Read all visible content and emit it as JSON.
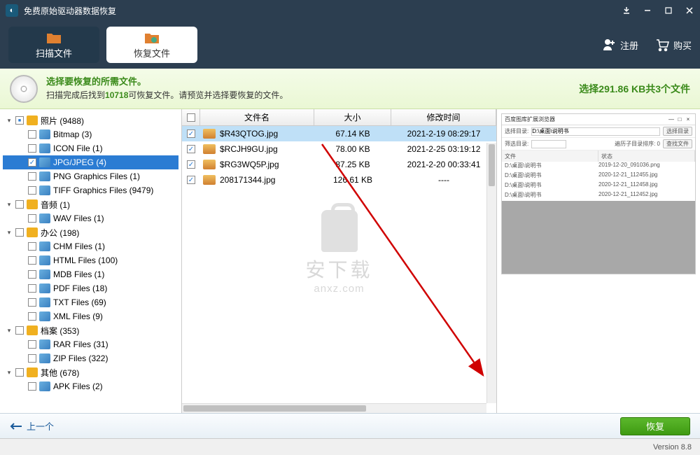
{
  "titlebar": {
    "title": "免费原始驱动器数据恢复"
  },
  "header": {
    "tab_scan": "扫描文件",
    "tab_recover": "恢复文件",
    "register": "注册",
    "buy": "购买"
  },
  "infobar": {
    "title": "选择要恢复的所需文件。",
    "prefix": "扫描完成后找到",
    "count": "10718",
    "suffix": "可恢复文件。请预览并选择要恢复的文件。",
    "selection": "选择291.86 KB共3个文件"
  },
  "sidebar": {
    "items": [
      {
        "indent": 0,
        "tri": "▾",
        "cb": "part",
        "icon": "cat",
        "label": "照片 (9488)"
      },
      {
        "indent": 1,
        "tri": "",
        "cb": "",
        "icon": "file",
        "label": "Bitmap (3)"
      },
      {
        "indent": 1,
        "tri": "",
        "cb": "",
        "icon": "file",
        "label": "ICON File (1)"
      },
      {
        "indent": 1,
        "tri": "",
        "cb": "chk",
        "icon": "file",
        "label": "JPG/JPEG (4)",
        "selected": true
      },
      {
        "indent": 1,
        "tri": "",
        "cb": "",
        "icon": "file",
        "label": "PNG Graphics Files (1)"
      },
      {
        "indent": 1,
        "tri": "",
        "cb": "",
        "icon": "file",
        "label": "TIFF Graphics Files (9479)"
      },
      {
        "indent": 0,
        "tri": "▾",
        "cb": "",
        "icon": "cat",
        "label": "音频 (1)"
      },
      {
        "indent": 1,
        "tri": "",
        "cb": "",
        "icon": "file",
        "label": "WAV Files (1)"
      },
      {
        "indent": 0,
        "tri": "▾",
        "cb": "",
        "icon": "cat",
        "label": "办公 (198)"
      },
      {
        "indent": 1,
        "tri": "",
        "cb": "",
        "icon": "file",
        "label": "CHM Files (1)"
      },
      {
        "indent": 1,
        "tri": "",
        "cb": "",
        "icon": "file",
        "label": "HTML Files (100)"
      },
      {
        "indent": 1,
        "tri": "",
        "cb": "",
        "icon": "file",
        "label": "MDB Files (1)"
      },
      {
        "indent": 1,
        "tri": "",
        "cb": "",
        "icon": "file",
        "label": "PDF Files (18)"
      },
      {
        "indent": 1,
        "tri": "",
        "cb": "",
        "icon": "file",
        "label": "TXT Files (69)"
      },
      {
        "indent": 1,
        "tri": "",
        "cb": "",
        "icon": "file",
        "label": "XML Files (9)"
      },
      {
        "indent": 0,
        "tri": "▾",
        "cb": "",
        "icon": "cat",
        "label": "档案 (353)"
      },
      {
        "indent": 1,
        "tri": "",
        "cb": "",
        "icon": "file",
        "label": "RAR Files (31)"
      },
      {
        "indent": 1,
        "tri": "",
        "cb": "",
        "icon": "file",
        "label": "ZIP Files (322)"
      },
      {
        "indent": 0,
        "tri": "▾",
        "cb": "",
        "icon": "cat",
        "label": "其他 (678)"
      },
      {
        "indent": 1,
        "tri": "",
        "cb": "",
        "icon": "file",
        "label": "APK Files (2)"
      }
    ]
  },
  "filelist": {
    "headers": {
      "name": "文件名",
      "size": "大小",
      "time": "修改时间"
    },
    "rows": [
      {
        "checked": true,
        "name": "$R43QTOG.jpg",
        "size": "67.14 KB",
        "time": "2021-2-19 08:29:17",
        "selected": true
      },
      {
        "checked": true,
        "name": "$RCJH9GU.jpg",
        "size": "78.00 KB",
        "time": "2021-2-25 03:19:12"
      },
      {
        "checked": true,
        "name": "$RG3WQ5P.jpg",
        "size": "87.25 KB",
        "time": "2021-2-20 00:33:41"
      },
      {
        "checked": true,
        "name": "208171344.jpg",
        "size": "126.61 KB",
        "time": "----"
      }
    ]
  },
  "watermark": {
    "t1": "安下载",
    "t2": "anxz.com"
  },
  "preview": {
    "title": "百度图库扩展浏览器",
    "path_label": "选择目录:",
    "path_value": "D:\\桌面\\说明书",
    "browse": "选择目录",
    "filter_label": "筛选目录:",
    "sub_label": "遍历子目录排序: 0",
    "go": "查找文件",
    "col1": "文件",
    "col2": "状态",
    "rows": [
      {
        "p": "D:\\桌面\\说明书",
        "f": "2019-12-20_091036.png"
      },
      {
        "p": "D:\\桌面\\说明书",
        "f": "2020-12-21_112455.jpg"
      },
      {
        "p": "D:\\桌面\\说明书",
        "f": "2020-12-21_112458.jpg"
      },
      {
        "p": "D:\\桌面\\说明书",
        "f": "2020-12-21_112452.jpg"
      }
    ]
  },
  "footer": {
    "back": "上一个",
    "recover": "恢复"
  },
  "version": "Version 8.8"
}
